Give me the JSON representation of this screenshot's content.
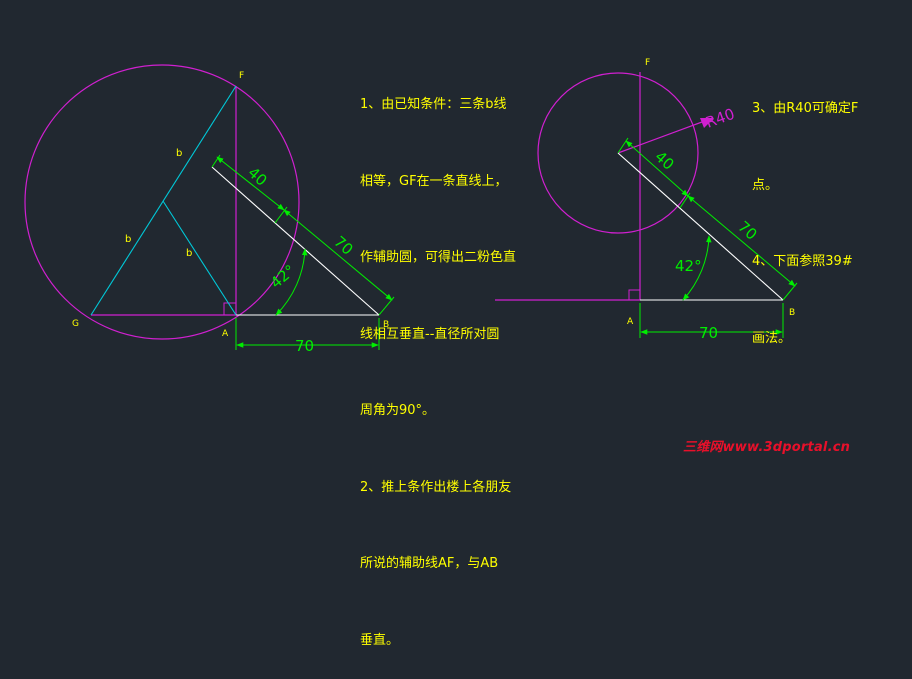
{
  "colors": {
    "background": "#212830",
    "circle": "#d020d0",
    "construction_line": "#d020d0",
    "triangle_sides": "#00c8d8",
    "hypotenuse": "#ffffff",
    "dimension": "#00ee00",
    "labels": "#ffff00",
    "watermark": "#e8102a"
  },
  "left_figure": {
    "points": {
      "F": "F",
      "G": "G",
      "A": "A",
      "B": "B"
    },
    "side_labels": [
      "b",
      "b",
      "b"
    ],
    "dimensions": {
      "length_40": "40",
      "length_70_slant": "70",
      "angle": "42°",
      "length_70_base": "70"
    }
  },
  "right_figure": {
    "points": {
      "F": "F",
      "A": "A",
      "B": "B"
    },
    "radius_label": "R40",
    "dimensions": {
      "length_40": "40",
      "length_70_slant": "70",
      "angle": "42°",
      "length_70_base": "70"
    }
  },
  "notes_left": {
    "lines": [
      "1、由已知条件：三条b线",
      "相等，GF在一条直线上，",
      "作辅助圆，可得出二粉色直",
      "线相互垂直--直径所对圆",
      "周角为90°。",
      "2、推上条作出楼上各朋友",
      "所说的辅助线AF，与AB",
      "垂直。"
    ]
  },
  "notes_right": {
    "lines": [
      "3、由R40可确定F",
      "点。",
      "4、下面参照39#",
      "画法。"
    ]
  },
  "watermark": "三维网www.3dportal.cn"
}
